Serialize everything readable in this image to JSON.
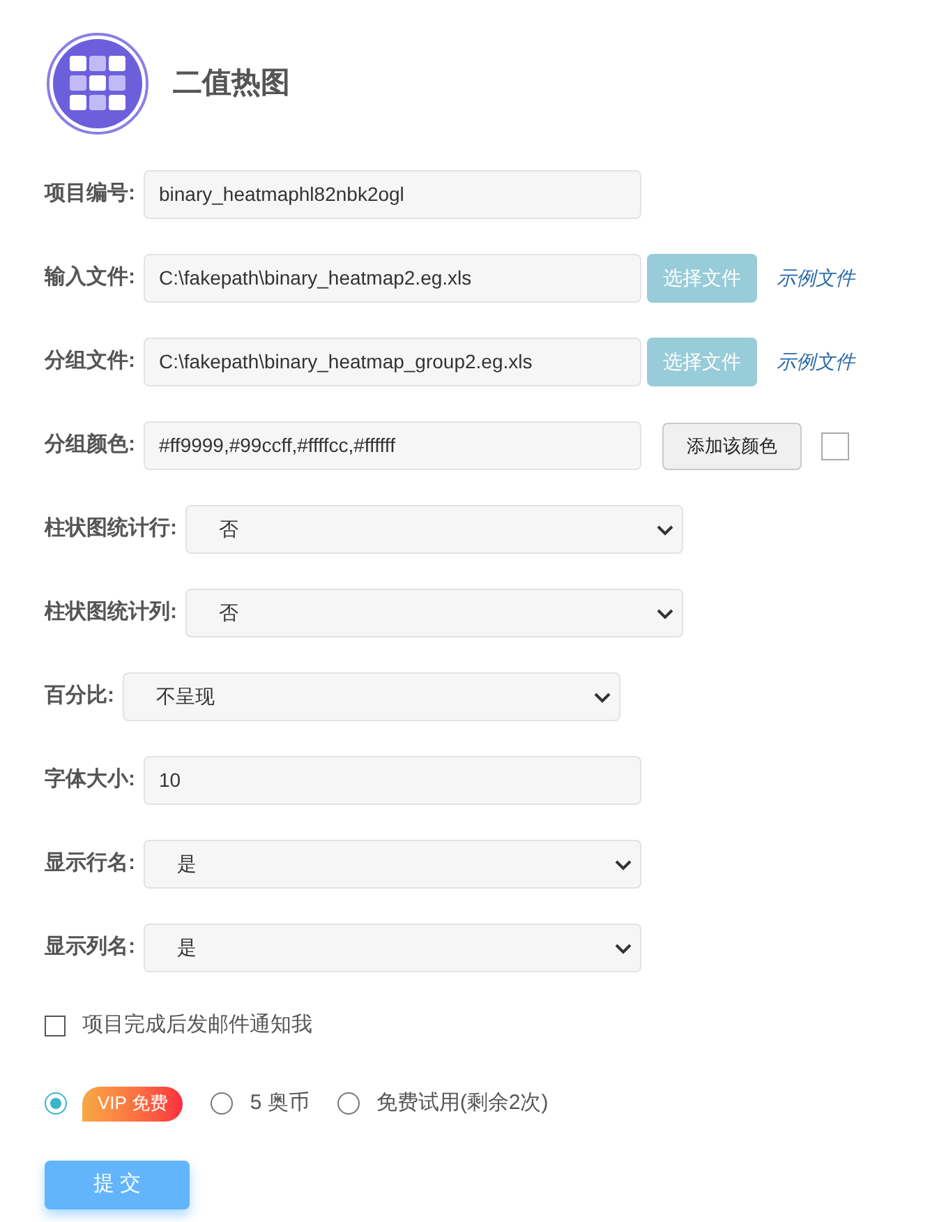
{
  "title": "二值热图",
  "fields": [
    {
      "kind": "text",
      "label": "项目编号:",
      "value": "binary_heatmaphl82nbk2ogl"
    },
    {
      "kind": "file",
      "label": "输入文件:",
      "value": "C:\\fakepath\\binary_heatmap2.eg.xls",
      "button": "选择文件",
      "link": "示例文件"
    },
    {
      "kind": "file",
      "label": "分组文件:",
      "value": "C:\\fakepath\\binary_heatmap_group2.eg.xls",
      "button": "选择文件",
      "link": "示例文件"
    },
    {
      "kind": "color",
      "label": "分组颜色:",
      "value": "#ff9999,#99ccff,#ffffcc,#ffffff",
      "button": "添加该颜色",
      "checked": false
    },
    {
      "kind": "select",
      "label": "柱状图统计行:",
      "value": "否"
    },
    {
      "kind": "select",
      "label": "柱状图统计列:",
      "value": "否"
    },
    {
      "kind": "select",
      "label": "百分比:",
      "value": "不呈现"
    },
    {
      "kind": "text",
      "label": "字体大小:",
      "value": "10"
    },
    {
      "kind": "select",
      "label": "显示行名:",
      "value": "是"
    },
    {
      "kind": "select",
      "label": "显示列名:",
      "value": "是"
    }
  ],
  "notify": {
    "label": "项目完成后发邮件通知我",
    "checked": false
  },
  "payment": [
    {
      "kind": "badge",
      "label": "VIP 免费",
      "selected": true
    },
    {
      "kind": "text",
      "label": "5 奥币",
      "selected": false
    },
    {
      "kind": "text",
      "label": "免费试用(剩余2次)",
      "selected": false
    }
  ],
  "submit": "提 交"
}
